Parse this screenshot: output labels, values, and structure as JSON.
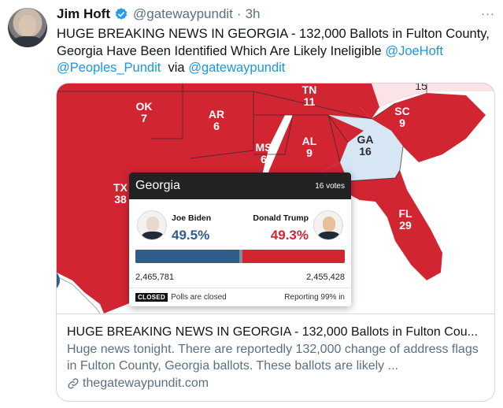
{
  "author": {
    "name": "Jim Hoft",
    "handle": "@gatewaypundit",
    "separator": "·",
    "time": "3h",
    "more": "···"
  },
  "tweet": {
    "text_part1": "HUGE BREAKING NEWS IN GEORGIA - 132,000 Ballots in Fulton County, Georgia Have Been Identified Which Are Likely Ineligible ",
    "mention1": "@JoeHoft",
    "mention2": "@Peoples_Pundit",
    "via": "via",
    "mention3": "@gatewaypundit"
  },
  "map": {
    "states": [
      {
        "abbr": "OK",
        "ev": "7"
      },
      {
        "abbr": "AR",
        "ev": "6"
      },
      {
        "abbr": "TN",
        "ev": "11"
      },
      {
        "abbr": "",
        "ev": "15"
      },
      {
        "abbr": "SC",
        "ev": "9"
      },
      {
        "abbr": "MS",
        "ev": "6"
      },
      {
        "abbr": "AL",
        "ev": "9"
      },
      {
        "abbr": "GA",
        "ev": "16"
      },
      {
        "abbr": "TX",
        "ev": "38"
      },
      {
        "abbr": "FL",
        "ev": "29"
      }
    ],
    "colors": {
      "rep": "#d22532",
      "dem_light": "#d6e6f5",
      "undecided": "#fbe3e6"
    }
  },
  "popup": {
    "state": "Georgia",
    "votes": "16 votes",
    "dem": {
      "name": "Joe Biden",
      "pct": "49.5%",
      "count": "2,465,781",
      "color": "#2e5c8d",
      "share": 0.495
    },
    "rep": {
      "name": "Donald Trump",
      "pct": "49.3%",
      "count": "2,455,428",
      "color": "#d22532"
    },
    "closed_badge": "CLOSED",
    "closed_text": "Polls are closed",
    "reporting": "Reporting 99% in"
  },
  "card": {
    "title": "HUGE BREAKING NEWS IN GEORGIA - 132,000 Ballots in Fulton Cou...",
    "description": "Huge news tonight.  There are reportedly 132,000 change of address flags in Fulton County, Georgia ballots. These ballots are likely ...",
    "domain": "thegatewaypundit.com"
  }
}
